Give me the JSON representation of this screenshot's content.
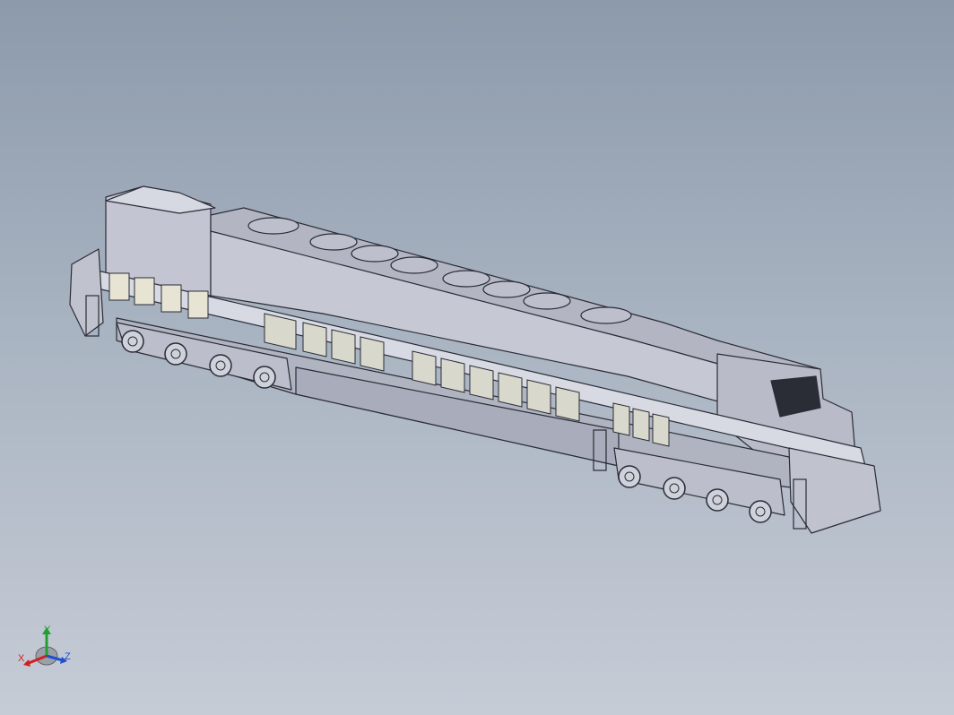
{
  "viewport": {
    "background_top": "#8c9aab",
    "background_bottom": "#c6ccd6"
  },
  "model": {
    "body_color": "#c8cad6",
    "edge_color": "#2a2c36",
    "shadow_color": "#555966"
  },
  "triad": {
    "x_label": "X",
    "y_label": "Y",
    "z_label": "Z",
    "x_color": "#d02020",
    "y_color": "#20a030",
    "z_color": "#2050d0"
  }
}
